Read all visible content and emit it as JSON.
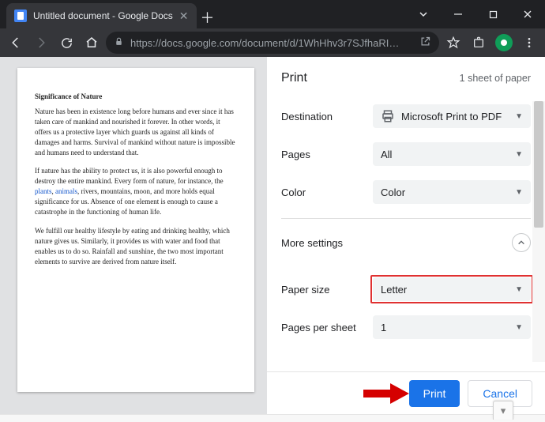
{
  "browser": {
    "tab_title": "Untitled document - Google Docs",
    "url": "https://docs.google.com/document/d/1WhHhv3r7SJfhaRI…"
  },
  "document": {
    "heading": "Significance of Nature",
    "para1": "Nature has been in existence long before humans and ever since it has taken care of mankind and nourished it forever. In other words, it offers us a protective layer which guards us against all kinds of damages and harms. Survival of mankind without nature is impossible and humans need to understand that.",
    "para2a": "If nature has the ability to protect us, it is also powerful enough to destroy the entire mankind. Every form of nature, for instance, the ",
    "link1": "plants",
    "para2b": ", ",
    "link2": "animals",
    "para2c": ", rivers, mountains, moon, and more holds equal significance for us. Absence of one element is enough to cause a catastrophe in the functioning of human life.",
    "para3": "We fulfill our healthy lifestyle by eating and drinking healthy, which nature gives us. Similarly, it provides us with water and food that enables us to do so. Rainfall and sunshine, the two most important elements to survive are derived from nature itself."
  },
  "print": {
    "title": "Print",
    "sheet_info": "1 sheet of paper",
    "rows": {
      "destination": {
        "label": "Destination",
        "value": "Microsoft Print to PDF"
      },
      "pages": {
        "label": "Pages",
        "value": "All"
      },
      "color": {
        "label": "Color",
        "value": "Color"
      },
      "paper_size": {
        "label": "Paper size",
        "value": "Letter"
      },
      "pages_per_sheet": {
        "label": "Pages per sheet",
        "value": "1"
      }
    },
    "more_settings": "More settings",
    "buttons": {
      "print": "Print",
      "cancel": "Cancel"
    }
  }
}
